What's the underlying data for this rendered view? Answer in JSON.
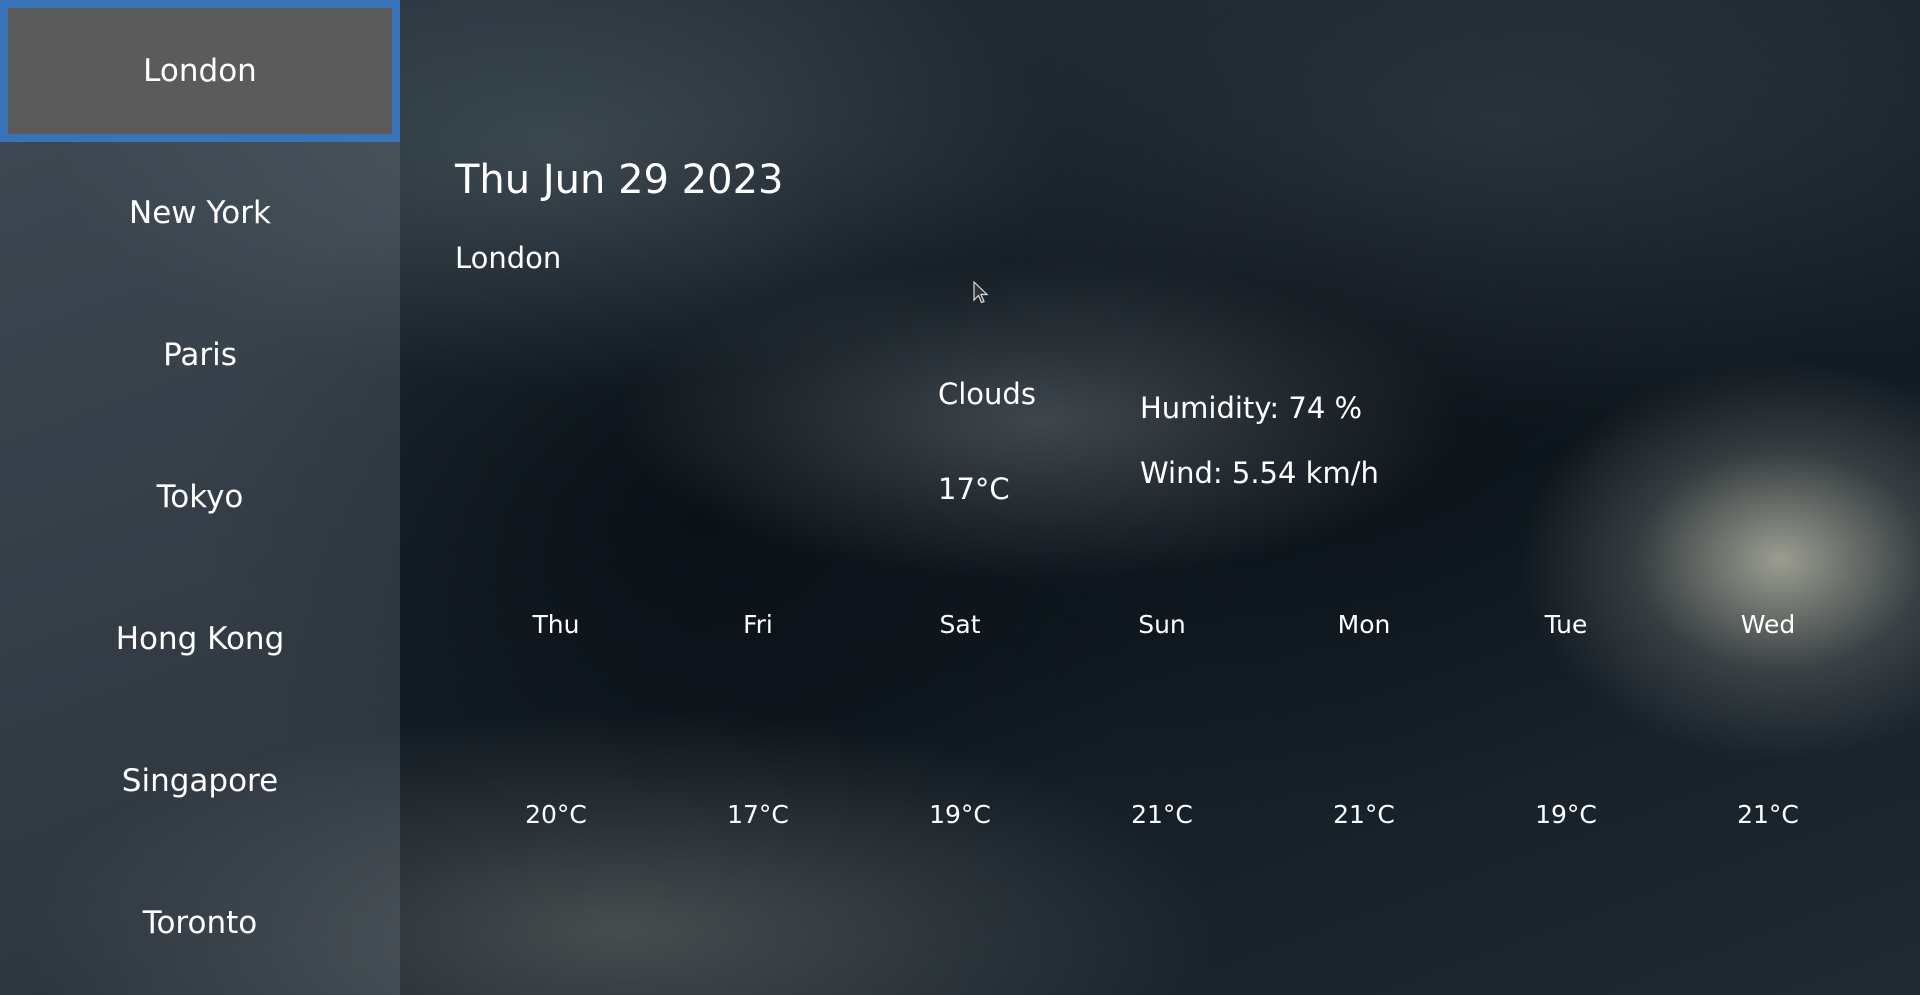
{
  "sidebar": {
    "cities": [
      {
        "name": "London",
        "selected": true
      },
      {
        "name": "New York",
        "selected": false
      },
      {
        "name": "Paris",
        "selected": false
      },
      {
        "name": "Tokyo",
        "selected": false
      },
      {
        "name": "Hong Kong",
        "selected": false
      },
      {
        "name": "Singapore",
        "selected": false
      },
      {
        "name": "Toronto",
        "selected": false
      }
    ]
  },
  "current": {
    "date": "Thu Jun 29 2023",
    "city": "London",
    "condition": "Clouds",
    "temperature": "17°C",
    "humidity": "Humidity: 74 %",
    "wind": "Wind: 5.54 km/h"
  },
  "forecast": [
    {
      "day": "Thu",
      "temp": "20°C"
    },
    {
      "day": "Fri",
      "temp": "17°C"
    },
    {
      "day": "Sat",
      "temp": "19°C"
    },
    {
      "day": "Sun",
      "temp": "21°C"
    },
    {
      "day": "Mon",
      "temp": "21°C"
    },
    {
      "day": "Tue",
      "temp": "19°C"
    },
    {
      "day": "Wed",
      "temp": "21°C"
    }
  ],
  "colors": {
    "selected_bg": "#5b5b5b",
    "selected_border": "#3a74b8",
    "text": "#ffffff"
  },
  "icons": {
    "cursor": "mouse-pointer-icon"
  }
}
